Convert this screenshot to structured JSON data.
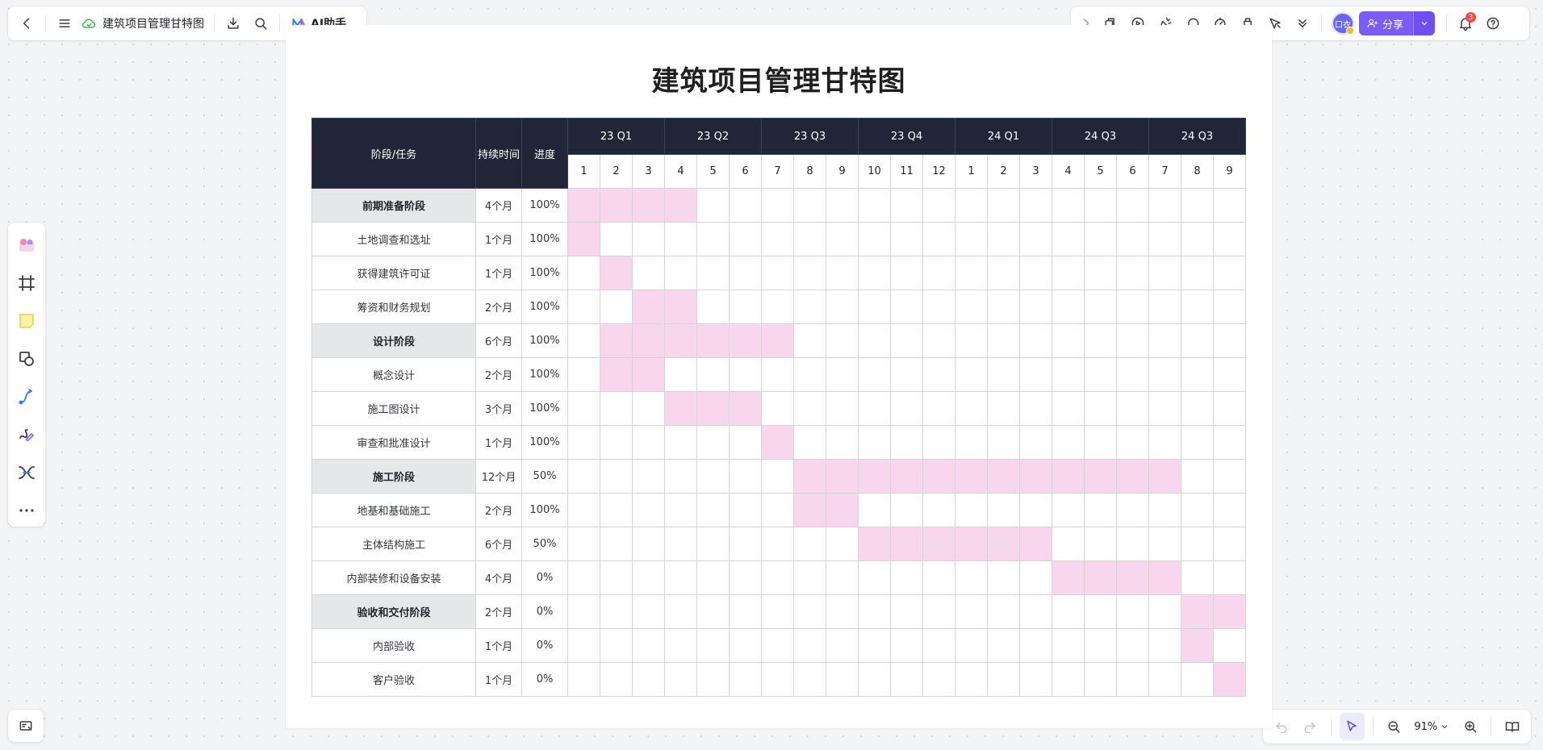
{
  "toolbar_left": {
    "doc_title": "建筑项目管理甘特图",
    "ai_label": "AI助手"
  },
  "toolbar_right": {
    "avatar_text": "口衣",
    "share_label": "分享",
    "notification_count": "3"
  },
  "zoom": {
    "level": "91%"
  },
  "colors": {
    "header_bg": "#1e2637",
    "bar": "#f8d7ee",
    "phase_bg": "#e6e7e9",
    "accent": "#7b5cf5"
  },
  "gantt": {
    "title": "建筑项目管理甘特图",
    "headers": {
      "task": "阶段/任务",
      "duration": "持续时间",
      "progress": "进度"
    },
    "quarters": [
      "23 Q1",
      "23 Q2",
      "23 Q3",
      "23 Q4",
      "24 Q1",
      "24 Q3",
      "24 Q3"
    ],
    "months": [
      "1",
      "2",
      "3",
      "4",
      "5",
      "6",
      "7",
      "8",
      "9",
      "10",
      "11",
      "12",
      "1",
      "2",
      "3",
      "4",
      "5",
      "6",
      "7",
      "8",
      "9"
    ],
    "rows": [
      {
        "name": "前期准备阶段",
        "duration": "4个月",
        "progress": "100%",
        "phase": true,
        "start": 0,
        "span": 4
      },
      {
        "name": "土地调查和选址",
        "duration": "1个月",
        "progress": "100%",
        "phase": false,
        "start": 0,
        "span": 1
      },
      {
        "name": "获得建筑许可证",
        "duration": "1个月",
        "progress": "100%",
        "phase": false,
        "start": 1,
        "span": 1
      },
      {
        "name": "筹资和财务规划",
        "duration": "2个月",
        "progress": "100%",
        "phase": false,
        "start": 2,
        "span": 2
      },
      {
        "name": "设计阶段",
        "duration": "6个月",
        "progress": "100%",
        "phase": true,
        "start": 1,
        "span": 6
      },
      {
        "name": "概念设计",
        "duration": "2个月",
        "progress": "100%",
        "phase": false,
        "start": 1,
        "span": 2
      },
      {
        "name": "施工图设计",
        "duration": "3个月",
        "progress": "100%",
        "phase": false,
        "start": 3,
        "span": 3
      },
      {
        "name": "审查和批准设计",
        "duration": "1个月",
        "progress": "100%",
        "phase": false,
        "start": 6,
        "span": 1
      },
      {
        "name": "施工阶段",
        "duration": "12个月",
        "progress": "50%",
        "phase": true,
        "start": 7,
        "span": 12
      },
      {
        "name": "地基和基础施工",
        "duration": "2个月",
        "progress": "100%",
        "phase": false,
        "start": 7,
        "span": 2
      },
      {
        "name": "主体结构施工",
        "duration": "6个月",
        "progress": "50%",
        "phase": false,
        "start": 9,
        "span": 6
      },
      {
        "name": "内部装修和设备安装",
        "duration": "4个月",
        "progress": "0%",
        "phase": false,
        "start": 15,
        "span": 4
      },
      {
        "name": "验收和交付阶段",
        "duration": "2个月",
        "progress": "0%",
        "phase": true,
        "start": 19,
        "span": 2
      },
      {
        "name": "内部验收",
        "duration": "1个月",
        "progress": "0%",
        "phase": false,
        "start": 19,
        "span": 1
      },
      {
        "name": "客户验收",
        "duration": "1个月",
        "progress": "0%",
        "phase": false,
        "start": 20,
        "span": 1
      }
    ]
  }
}
